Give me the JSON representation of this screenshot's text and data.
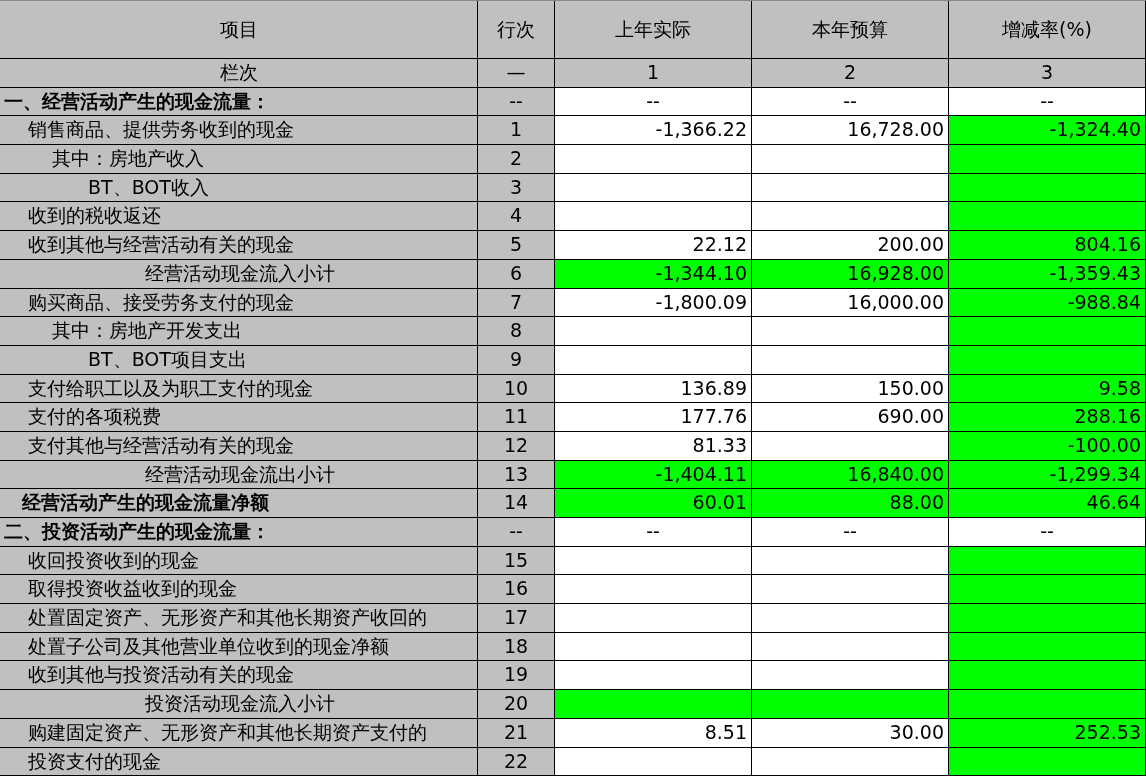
{
  "header": {
    "columns": [
      "项目",
      "行次",
      "上年实际",
      "本年预算",
      "增减率(%)"
    ]
  },
  "column_numbers": {
    "label": "栏次",
    "line": "—",
    "numbers": [
      "1",
      "2",
      "3"
    ]
  },
  "rows": [
    {
      "kind": "section",
      "item": "一、经营活动产生的现金流量：",
      "line": "--",
      "cells": [
        {
          "text": "--",
          "highlight": false
        },
        {
          "text": "--",
          "highlight": false
        },
        {
          "text": "--",
          "highlight": false
        }
      ]
    },
    {
      "kind": "item",
      "item": "销售商品、提供劳务收到的现金",
      "line": "1",
      "cells": [
        {
          "text": "-1,366.22",
          "highlight": false
        },
        {
          "text": "16,728.00",
          "highlight": false
        },
        {
          "text": "-1,324.40",
          "highlight": true
        }
      ]
    },
    {
      "kind": "sub",
      "item": "其中：房地产收入",
      "line": "2",
      "cells": [
        {
          "highlight": false
        },
        {
          "highlight": false
        },
        {
          "highlight": true
        }
      ]
    },
    {
      "kind": "subsub",
      "item": "BT、BOT收入",
      "line": "3",
      "cells": [
        {
          "highlight": false
        },
        {
          "highlight": false
        },
        {
          "highlight": true
        }
      ]
    },
    {
      "kind": "item",
      "item": "收到的税收返还",
      "line": "4",
      "cells": [
        {
          "highlight": false
        },
        {
          "highlight": false
        },
        {
          "highlight": true
        }
      ]
    },
    {
      "kind": "item",
      "item": "收到其他与经营活动有关的现金",
      "line": "5",
      "cells": [
        {
          "text": "22.12",
          "highlight": false
        },
        {
          "text": "200.00",
          "highlight": false
        },
        {
          "text": "804.16",
          "highlight": true
        }
      ]
    },
    {
      "kind": "subtotal",
      "item": "经营活动现金流入小计",
      "line": "6",
      "cells": [
        {
          "text": "-1,344.10",
          "highlight": true
        },
        {
          "text": "16,928.00",
          "highlight": true
        },
        {
          "text": "-1,359.43",
          "highlight": true
        }
      ]
    },
    {
      "kind": "item",
      "item": "购买商品、接受劳务支付的现金",
      "line": "7",
      "cells": [
        {
          "text": "-1,800.09",
          "highlight": false
        },
        {
          "text": "16,000.00",
          "highlight": false
        },
        {
          "text": "-988.84",
          "highlight": true
        }
      ]
    },
    {
      "kind": "sub",
      "item": "其中：房地产开发支出",
      "line": "8",
      "cells": [
        {
          "highlight": false
        },
        {
          "highlight": false
        },
        {
          "highlight": true
        }
      ]
    },
    {
      "kind": "subsub",
      "item": "BT、BOT项目支出",
      "line": "9",
      "cells": [
        {
          "highlight": false
        },
        {
          "highlight": false
        },
        {
          "highlight": true
        }
      ]
    },
    {
      "kind": "item",
      "item": "支付给职工以及为职工支付的现金",
      "line": "10",
      "cells": [
        {
          "text": "136.89",
          "highlight": false
        },
        {
          "text": "150.00",
          "highlight": false
        },
        {
          "text": "9.58",
          "highlight": true
        }
      ]
    },
    {
      "kind": "item",
      "item": "支付的各项税费",
      "line": "11",
      "cells": [
        {
          "text": "177.76",
          "highlight": false
        },
        {
          "text": "690.00",
          "highlight": false
        },
        {
          "text": "288.16",
          "highlight": true
        }
      ]
    },
    {
      "kind": "item",
      "item": "支付其他与经营活动有关的现金",
      "line": "12",
      "cells": [
        {
          "text": "81.33",
          "highlight": false
        },
        {
          "highlight": false
        },
        {
          "text": "-100.00",
          "highlight": true
        }
      ]
    },
    {
      "kind": "subtotal",
      "item": "经营活动现金流出小计",
      "line": "13",
      "cells": [
        {
          "text": "-1,404.11",
          "highlight": true
        },
        {
          "text": "16,840.00",
          "highlight": true
        },
        {
          "text": "-1,299.34",
          "highlight": true
        }
      ]
    },
    {
      "kind": "total",
      "item": "经营活动产生的现金流量净额",
      "line": "14",
      "cells": [
        {
          "text": "60.01",
          "highlight": true
        },
        {
          "text": "88.00",
          "highlight": true
        },
        {
          "text": "46.64",
          "highlight": true
        }
      ]
    },
    {
      "kind": "section",
      "item": "二、投资活动产生的现金流量：",
      "line": "--",
      "cells": [
        {
          "text": "--",
          "highlight": false
        },
        {
          "text": "--",
          "highlight": false
        },
        {
          "text": "--",
          "highlight": false
        }
      ]
    },
    {
      "kind": "item",
      "item": "收回投资收到的现金",
      "line": "15",
      "cells": [
        {
          "highlight": false
        },
        {
          "highlight": false
        },
        {
          "highlight": true
        }
      ]
    },
    {
      "kind": "item",
      "item": "取得投资收益收到的现金",
      "line": "16",
      "cells": [
        {
          "highlight": false
        },
        {
          "highlight": false
        },
        {
          "highlight": true
        }
      ]
    },
    {
      "kind": "item",
      "item": "处置固定资产、无形资产和其他长期资产收回的",
      "line": "17",
      "cells": [
        {
          "highlight": false
        },
        {
          "highlight": false
        },
        {
          "highlight": true
        }
      ]
    },
    {
      "kind": "item",
      "item": "处置子公司及其他营业单位收到的现金净额",
      "line": "18",
      "cells": [
        {
          "highlight": false
        },
        {
          "highlight": false
        },
        {
          "highlight": true
        }
      ]
    },
    {
      "kind": "item",
      "item": "收到其他与投资活动有关的现金",
      "line": "19",
      "cells": [
        {
          "highlight": false
        },
        {
          "highlight": false
        },
        {
          "highlight": true
        }
      ]
    },
    {
      "kind": "subtotal",
      "item": "投资活动现金流入小计",
      "line": "20",
      "cells": [
        {
          "highlight": true
        },
        {
          "highlight": true
        },
        {
          "highlight": true
        }
      ]
    },
    {
      "kind": "item",
      "item": "购建固定资产、无形资产和其他长期资产支付的",
      "line": "21",
      "cells": [
        {
          "text": "8.51",
          "highlight": false
        },
        {
          "text": "30.00",
          "highlight": false
        },
        {
          "text": "252.53",
          "highlight": true
        }
      ]
    },
    {
      "kind": "item",
      "item": "投资支付的现金",
      "line": "22",
      "cells": [
        {
          "highlight": false
        },
        {
          "highlight": false
        },
        {
          "highlight": true
        }
      ]
    }
  ]
}
